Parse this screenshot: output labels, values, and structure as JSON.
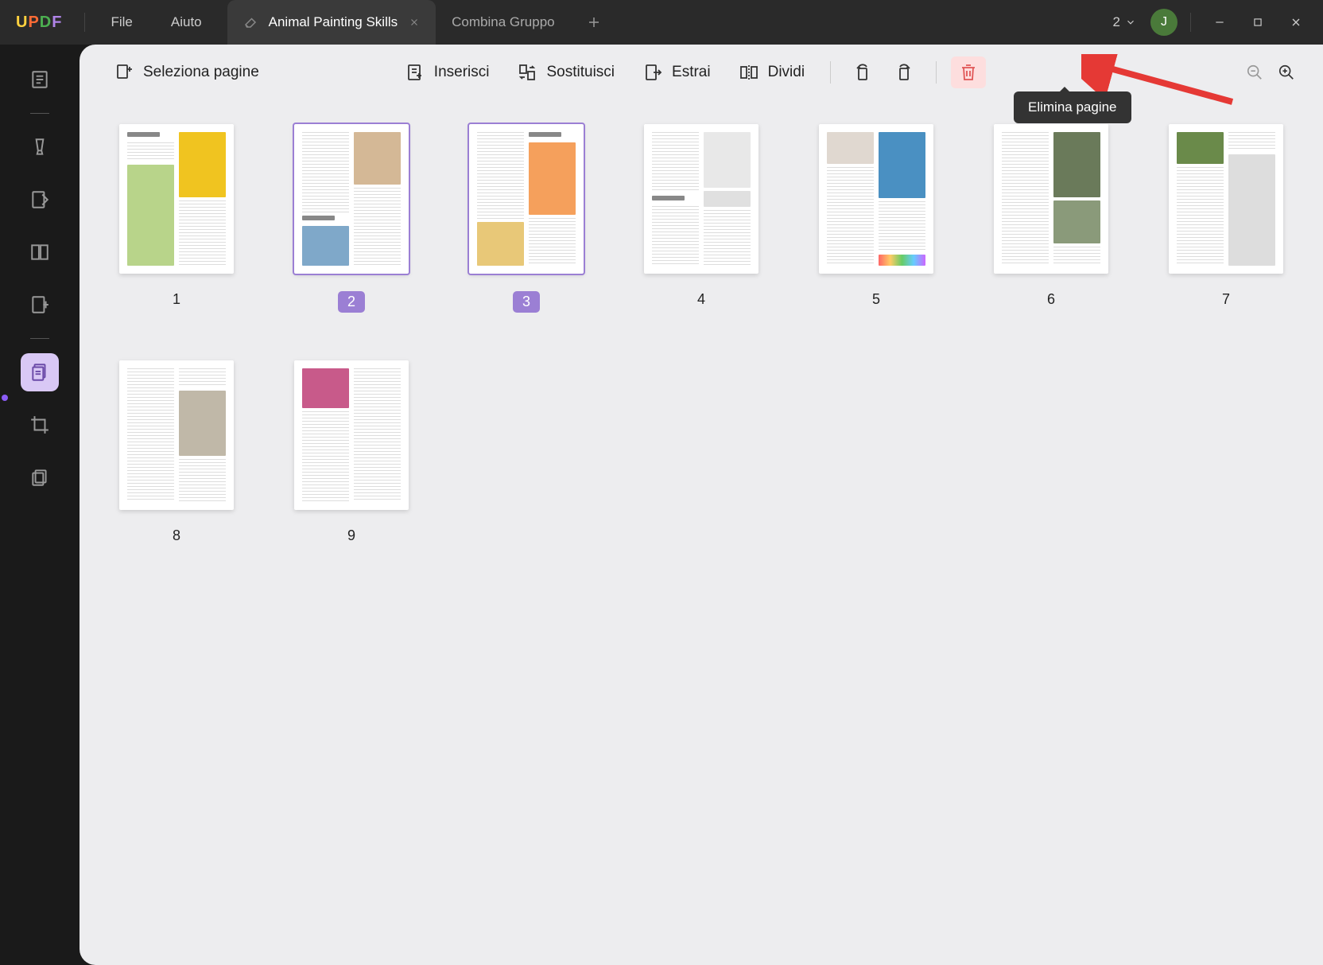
{
  "titlebar": {
    "logo": "UPDF",
    "menu": {
      "file": "File",
      "help": "Aiuto"
    },
    "tabs": [
      {
        "label": "Animal Painting Skills",
        "active": true,
        "closable": true
      },
      {
        "label": "Combina Gruppo",
        "active": false,
        "closable": false
      }
    ],
    "count": "2",
    "avatar": "J"
  },
  "toolbar": {
    "select": "Seleziona pagine",
    "insert": "Inserisci",
    "replace": "Sostituisci",
    "extract": "Estrai",
    "split": "Dividi"
  },
  "tooltip": "Elimina pagine",
  "pages": [
    {
      "num": "1",
      "selected": false,
      "layout": "p1"
    },
    {
      "num": "2",
      "selected": true,
      "layout": "p2"
    },
    {
      "num": "3",
      "selected": true,
      "layout": "p3"
    },
    {
      "num": "4",
      "selected": false,
      "layout": "p4"
    },
    {
      "num": "5",
      "selected": false,
      "layout": "p5"
    },
    {
      "num": "6",
      "selected": false,
      "layout": "p6"
    },
    {
      "num": "7",
      "selected": false,
      "layout": "p7"
    },
    {
      "num": "8",
      "selected": false,
      "layout": "p8"
    },
    {
      "num": "9",
      "selected": false,
      "layout": "p9"
    }
  ],
  "thumb_colors": {
    "p1_a": "#f0c420",
    "p1_b": "#b8d48a",
    "p2_a": "#d4b896",
    "p2_b": "#7fa8c9",
    "p3_a": "#f5a05c",
    "p3_b": "#e8c878",
    "p4_a": "#e8e8e8",
    "p4_b": "#e0e0e0",
    "p5_a": "#4a90c2",
    "p5_b": "linear-gradient(90deg,#f66,#fc6,#6c6,#6cf,#c6f)",
    "p6_a": "#6a7a5a",
    "p6_b": "#8a9a7a",
    "p7_a": "#6a8a4a",
    "p7_b": "#ddd",
    "p8_a": "#c0b8a8",
    "p8_b": "#d0c8b8",
    "p9_a": "#c85a8a"
  }
}
